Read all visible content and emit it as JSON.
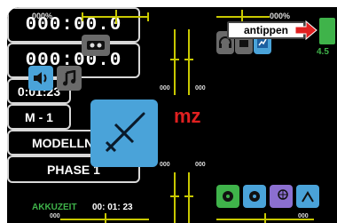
{
  "trims": {
    "top_left_percent": "000%",
    "top_right_percent": "000%",
    "center_left_value": "000",
    "center_right_value": "000",
    "bottom_left_value": "000",
    "bottom_right_value": "000",
    "bottom_mid_left_value": "000",
    "bottom_mid_right_value": "000"
  },
  "callout": {
    "label": "antippen"
  },
  "model": {
    "timer_small": "0:01:23",
    "memory": "M - 1",
    "name": "MODELLNAME  1",
    "akku_label": "AKKUZEIT",
    "akku_time": "00: 01: 23",
    "type_letters": "mz"
  },
  "timers": {
    "top": "000:00.0",
    "bottom": "000:00.0"
  },
  "phase": {
    "label": "PHASE 1"
  },
  "voltage": {
    "value": "4.5"
  },
  "colors": {
    "accent_blue": "#4aa3d9",
    "accent_red": "#e02020",
    "trim_yellow": "#c8c800",
    "status_green": "#3fb34a"
  }
}
